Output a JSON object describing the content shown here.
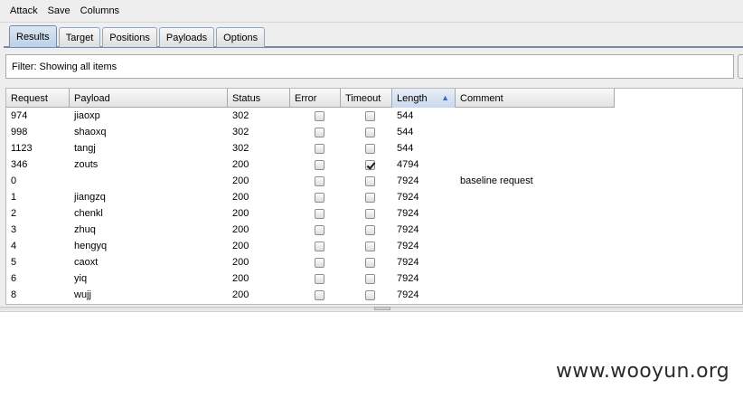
{
  "menu": {
    "items": [
      "Attack",
      "Save",
      "Columns"
    ]
  },
  "tabs": [
    {
      "label": "Results",
      "active": true
    },
    {
      "label": "Target"
    },
    {
      "label": "Positions"
    },
    {
      "label": "Payloads"
    },
    {
      "label": "Options"
    }
  ],
  "filter": {
    "text": "Filter:  Showing all items"
  },
  "table": {
    "columns": [
      "Request",
      "Payload",
      "Status",
      "Error",
      "Timeout",
      "Length",
      "Comment"
    ],
    "sorted_column": "Length",
    "rows": [
      {
        "request": "974",
        "payload": "jiaoxp",
        "status": "302",
        "error": false,
        "timeout": false,
        "length": "544",
        "comment": ""
      },
      {
        "request": "998",
        "payload": "shaoxq",
        "status": "302",
        "error": false,
        "timeout": false,
        "length": "544",
        "comment": ""
      },
      {
        "request": "1123",
        "payload": "tangj",
        "status": "302",
        "error": false,
        "timeout": false,
        "length": "544",
        "comment": ""
      },
      {
        "request": "346",
        "payload": "zouts",
        "status": "200",
        "error": false,
        "timeout": true,
        "length": "4794",
        "comment": ""
      },
      {
        "request": "0",
        "payload": "",
        "status": "200",
        "error": false,
        "timeout": false,
        "length": "7924",
        "comment": "baseline request"
      },
      {
        "request": "1",
        "payload": "jiangzq",
        "status": "200",
        "error": false,
        "timeout": false,
        "length": "7924",
        "comment": ""
      },
      {
        "request": "2",
        "payload": "chenkl",
        "status": "200",
        "error": false,
        "timeout": false,
        "length": "7924",
        "comment": ""
      },
      {
        "request": "3",
        "payload": "zhuq",
        "status": "200",
        "error": false,
        "timeout": false,
        "length": "7924",
        "comment": ""
      },
      {
        "request": "4",
        "payload": "hengyq",
        "status": "200",
        "error": false,
        "timeout": false,
        "length": "7924",
        "comment": ""
      },
      {
        "request": "5",
        "payload": "caoxt",
        "status": "200",
        "error": false,
        "timeout": false,
        "length": "7924",
        "comment": ""
      },
      {
        "request": "6",
        "payload": "yiq",
        "status": "200",
        "error": false,
        "timeout": false,
        "length": "7924",
        "comment": ""
      },
      {
        "request": "8",
        "payload": "wujj",
        "status": "200",
        "error": false,
        "timeout": false,
        "length": "7924",
        "comment": ""
      }
    ]
  },
  "watermark": "www.wooyun.org"
}
